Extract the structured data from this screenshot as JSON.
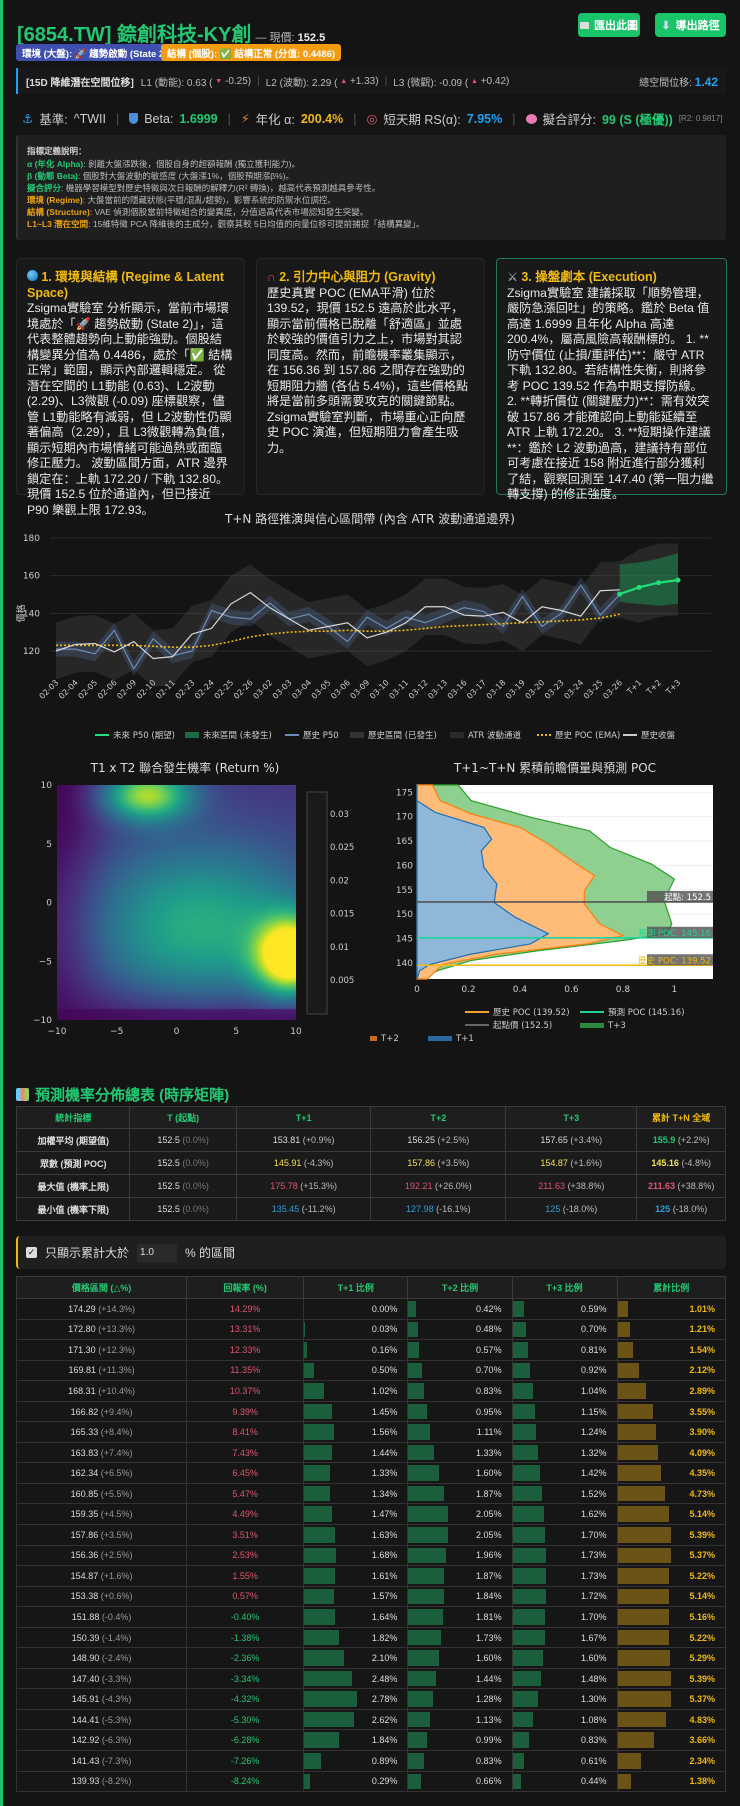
{
  "header": {
    "title": "[6854.TW] 錼創科技-KY創",
    "price_label": "— 現價:",
    "price": "152.5",
    "export_chart": "匯出此圖",
    "export_path": "導出路徑"
  },
  "badges": {
    "regime": "環境 (大盤): 🚀 趨勢啟動 (State 2)",
    "structure": "結構 (個股): ✅ 結構正常 (分值: 0.4486)",
    "regime_color": "#3f4fb0",
    "structure_color": "#f39c12"
  },
  "latent": {
    "label": "[15D 降維潛在空間位移]",
    "l1": "L1 (動能): 0.63 (",
    "l1_arrow": "▼",
    "l1_delta": "-0.25)",
    "l2": "L2 (波動): 2.29 (",
    "l2_arrow": "▲",
    "l2_delta": "+1.33)",
    "l3": "L3 (微觀): -0.09 (",
    "l3_arrow": "▲",
    "l3_delta": "+0.42)",
    "total_label": "總空間位移:",
    "total": "1.42"
  },
  "metrics": {
    "bench_label": "基準:",
    "bench": "^TWII",
    "beta_label": "Beta:",
    "beta": "1.6999",
    "alpha_label": "年化 α:",
    "alpha": "200.4%",
    "rs_label": "短天期 RS(α):",
    "rs": "7.95%",
    "fit_label": "擬合評分:",
    "fit": "99 (S (極優))",
    "r2": "[R2: 0.9817]"
  },
  "defs": {
    "title": "指標定義說明：",
    "items": [
      {
        "k": "α (年化 Alpha)",
        "v": ": 剝離大盤漲跌後，個股自身的超額報酬 (獨立獲利能力)。"
      },
      {
        "k": "β (動態 Beta)",
        "v": ": 個股對大盤波動的敏感度 (大盤漲1%，個股預期漲β%)。"
      },
      {
        "k": "擬合評分",
        "v": ": 機器學習模型對歷史特徵與次日報酬的解釋力(R² 轉換)，越高代表預測越具參考性。"
      },
      {
        "k": "環境 (Regime)",
        "v": ": 大盤當前的隱藏狀態(平穩/混亂/趨勢)，影響系統的防禦水位調控。"
      },
      {
        "k": "結構 (Structure)",
        "v": ": VAE 偵測個股當前特徵組合的變異度，分值過高代表市場認知發生突變。"
      },
      {
        "k": "L1~L3 潛在空間",
        "v": ": 15維特徵 PCA 降維後的主成分，觀察其較 5日均值的向量位移可提前捕捉「結構異變」。"
      }
    ]
  },
  "cards": [
    {
      "title": "1. 環境與結構 (Regime & Latent Space)",
      "body": "Zsigma實驗室 分析顯示，當前市場環境處於「🚀 趨勢啟動 (State 2)」，這代表整體趨勢向上動能強勁。個股結構變異分值為 0.4486，處於「✅ 結構正常」範圍，顯示內部邏輯穩定。 從潛在空間的 L1動能 (0.63)、L2波動 (2.29)、L3微觀 (-0.09) 座標觀察，儘管 L1動能略有減弱，但 L2波動性仍顯著偏高（2.29），且 L3微觀轉為負值，顯示短期內市場情緒可能過熱或面臨修正壓力。 波動區間方面，ATR 邊界鎖定在：上軌 172.20 / 下軌 132.80。現價 152.5 位於通道內，但已接近 P90 樂觀上限 172.93。"
    },
    {
      "title": "2. 引力中心與阻力 (Gravity)",
      "body": "歷史真實 POC (EMA平滑) 位於 139.52，現價 152.5 遠高於此水平，顯示當前價格已脫離「舒適區」並處於較強的價值引力之上，市場對其認同度高。然而，前瞻機率叢集顯示，在 156.36 到 157.86 之間存在強勁的短期阻力牆 (各佔 5.4%)，這些價格點將是當前多頭需要攻克的關鍵節點。Zsigma實驗室判斷，市場重心正向歷史 POC 演進，但短期阻力會產生吸力。"
    },
    {
      "title": "3. 操盤劇本 (Execution)",
      "body": "Zsigma實驗室 建議採取「順勢管理，嚴防急漲回吐」的策略。鑑於 Beta 值高達 1.6999 且年化 Alpha 高達 200.4%，屬高風險高報酬標的。 1. **防守價位 (止損/重評估)**：嚴守 ATR 下軌 132.80。若結構性失衡，則將參考 POC 139.52 作為中期支撐防線。 2. **轉折價位 (關鍵壓力)**：需有效突破 157.86 才能確認向上動能延續至 ATR 上軌 172.20。 3. **短期操作建議**：鑑於 L2 波動過高，建議持有部位可考慮在接近 158 附近進行部分獲利了結，觀察回測至 147.40 (第一阻力繼轉支撐) 的修正強度。"
    }
  ],
  "chart_data": [
    {
      "type": "line",
      "title": "T+N 路徑推演與信心區間帶 (內含 ATR 波動通道邊界)",
      "ylabel": "價格",
      "ylim": [
        98,
        182
      ],
      "yticks": [
        "120",
        "140",
        "160",
        "180"
      ],
      "x": [
        "02-03",
        "02-04",
        "02-05",
        "02-06",
        "02-09",
        "02-10",
        "02-11",
        "02-23",
        "02-24",
        "02-25",
        "02-26",
        "03-02",
        "03-03",
        "03-04",
        "03-05",
        "03-06",
        "03-09",
        "03-10",
        "03-11",
        "03-12",
        "03-13",
        "03-16",
        "03-17",
        "03-18",
        "03-19",
        "03-20",
        "03-23",
        "03-24",
        "03-25",
        "03-26",
        "T+1",
        "T+2",
        "T+3"
      ],
      "hist_close": [
        120,
        123.5,
        124,
        119.5,
        125,
        116,
        117,
        129,
        132,
        145,
        151,
        143,
        137,
        131,
        133,
        135,
        127,
        130,
        135,
        143.5,
        143.5,
        139,
        138.5,
        140.5,
        135,
        143.5,
        141.5,
        138.5,
        152,
        152.5
      ],
      "hist_p50": [
        121,
        121,
        118.5,
        131,
        110.5,
        126.5,
        117.5,
        120,
        141.5,
        138,
        137,
        145.5,
        137,
        139.5,
        133,
        125,
        138,
        132,
        138,
        135,
        139,
        143,
        141,
        133,
        149,
        133,
        140,
        155,
        139,
        150
      ],
      "hist_band_halfwidth": 4,
      "poc_ema": [
        123,
        123,
        123,
        123,
        123,
        122.5,
        122,
        122,
        123,
        125,
        127.5,
        129,
        130,
        130.5,
        130.5,
        131,
        130.5,
        130.5,
        131,
        132,
        133,
        133.5,
        134,
        134.5,
        135,
        135.5,
        136,
        136.5,
        137.5,
        139.5
      ],
      "atr_upper": [
        135,
        138.5,
        139,
        134.5,
        140,
        131,
        132,
        144,
        147,
        160,
        166,
        158,
        152,
        146,
        148,
        150,
        142,
        145,
        150,
        158.5,
        158.5,
        154,
        153.5,
        155.5,
        150,
        158.5,
        156.5,
        153.5,
        167,
        167.5,
        174,
        177,
        177
      ],
      "atr_lower": [
        105,
        108.5,
        109,
        104.5,
        110,
        101,
        102,
        114,
        117,
        130,
        136,
        128,
        122,
        116,
        118,
        120,
        112,
        115,
        120,
        128.5,
        128.5,
        124,
        123.5,
        125.5,
        120,
        128.5,
        126.5,
        123.5,
        137,
        137.5,
        135,
        138,
        139
      ],
      "future_p50": [
        150.2,
        153.81,
        156.25,
        157.65
      ],
      "future_lower": [
        146,
        145,
        144,
        145
      ],
      "future_upper": [
        166,
        167,
        169,
        172
      ],
      "legend": [
        "未來 P50 (期望)",
        "未來區間 (未發生)",
        "歷史 P50",
        "歷史區間 (已發生)",
        "ATR 波動通道",
        "歷史 POC (EMA)",
        "歷史收盤"
      ]
    },
    {
      "type": "heatmap",
      "title": "T1 x T2 聯合發生機率 (Return %)",
      "xlim": [
        -10,
        10
      ],
      "ylim": [
        -10,
        10
      ],
      "xticks": [
        "−10",
        "−5",
        "0",
        "5",
        "10"
      ],
      "yticks": [
        "10",
        "5",
        "0",
        "−5",
        "−10"
      ],
      "colorbar_ticks": [
        "0.03",
        "0.025",
        "0.02",
        "0.015",
        "0.01",
        "0.005"
      ],
      "peaks": [
        {
          "x": 9.5,
          "y": -4.5,
          "value": 0.034,
          "sx": 2.0,
          "sy": 2.2
        },
        {
          "x": -2.5,
          "y": 9.2,
          "value": 0.024,
          "sx": 2.5,
          "sy": 1.5
        },
        {
          "x": 2,
          "y": -2,
          "value": 0.016,
          "sx": 7,
          "sy": 5
        }
      ],
      "base": 0.005
    },
    {
      "type": "area",
      "title": "T+1~T+N 累積前瞻價量與預測 POC",
      "xlim": [
        0,
        1.15
      ],
      "ylim": [
        136.7,
        176.5
      ],
      "xticks": [
        "0",
        "0.2",
        "0.4",
        "0.6",
        "0.8",
        "1"
      ],
      "yticks": [
        "140",
        "145",
        "150",
        "155",
        "160",
        "165",
        "170",
        "175"
      ],
      "t1": [
        [
          176.5,
          0
        ],
        [
          173.3,
          0
        ],
        [
          170.9,
          0.07
        ],
        [
          167.8,
          0.26
        ],
        [
          165.4,
          0.29
        ],
        [
          163,
          0.25
        ],
        [
          159.6,
          0.26
        ],
        [
          156.2,
          0.31
        ],
        [
          152.4,
          0.3
        ],
        [
          149.4,
          0.38
        ],
        [
          146,
          0.51
        ],
        [
          143.9,
          0.44
        ],
        [
          141.8,
          0.21
        ],
        [
          139.7,
          0.05
        ],
        [
          138.4,
          0.01
        ],
        [
          136.7,
          0
        ]
      ],
      "t2": [
        [
          176.5,
          0.06
        ],
        [
          173.3,
          0.09
        ],
        [
          170.6,
          0.21
        ],
        [
          167.8,
          0.4
        ],
        [
          164.4,
          0.51
        ],
        [
          161,
          0.6
        ],
        [
          157.9,
          0.69
        ],
        [
          154.8,
          0.65
        ],
        [
          152.1,
          0.65
        ],
        [
          148,
          0.71
        ],
        [
          145.6,
          0.8
        ],
        [
          143.9,
          0.66
        ],
        [
          141.8,
          0.31
        ],
        [
          139.7,
          0.1
        ],
        [
          136.7,
          0.04
        ]
      ],
      "t3": [
        [
          176.5,
          0.16
        ],
        [
          173.3,
          0.21
        ],
        [
          169.9,
          0.44
        ],
        [
          167.1,
          0.67
        ],
        [
          163.7,
          0.75
        ],
        [
          160.3,
          0.91
        ],
        [
          157.2,
          1.0
        ],
        [
          152.8,
          0.96
        ],
        [
          148,
          0.99
        ],
        [
          146,
          0.97
        ],
        [
          144.6,
          0.8
        ],
        [
          142.5,
          0.47
        ],
        [
          140.5,
          0.21
        ],
        [
          138.4,
          0.08
        ],
        [
          136.7,
          0.01
        ]
      ],
      "hist_poc": 139.52,
      "pred_poc": 145.16,
      "start": 152.5,
      "labels": {
        "start": "起點: 152.5",
        "pred": "預測 POC: 145.16",
        "hist": "歷史 POC: 139.52"
      },
      "legend": [
        "歷史 POC (139.52)",
        "預測 POC (145.16)",
        "起點價 (152.5)",
        "T+3",
        "T+2",
        "T+1"
      ]
    }
  ],
  "summary": {
    "title": "預測機率分佈總表 (時序矩陣)",
    "headers": [
      "統計指標",
      "T (起點)",
      "T+1",
      "T+2",
      "T+3",
      "累計 T+N 全域"
    ],
    "rows": [
      {
        "label": "加權平均 (期望值)",
        "color": "#dddddd",
        "cum_color": "#21c873",
        "cells": [
          [
            "152.5",
            "(0.0%)"
          ],
          [
            "153.81",
            "(+0.9%)"
          ],
          [
            "156.25",
            "(+2.5%)"
          ],
          [
            "157.65",
            "(+3.4%)"
          ],
          [
            "155.9",
            "(+2.2%)"
          ]
        ]
      },
      {
        "label": "眾數 (預測 POC)",
        "color": "#f5e050",
        "cum_color": "#f5e050",
        "cells": [
          [
            "152.5",
            "(0.0%)"
          ],
          [
            "145.91",
            "(-4.3%)"
          ],
          [
            "157.86",
            "(+3.5%)"
          ],
          [
            "154.87",
            "(+1.6%)"
          ],
          [
            "145.16",
            "(-4.8%)"
          ]
        ]
      },
      {
        "label": "最大值 (機率上限)",
        "color": "#e0556f",
        "cum_color": "#e0556f",
        "cells": [
          [
            "152.5",
            "(0.0%)"
          ],
          [
            "175.78",
            "(+15.3%)"
          ],
          [
            "192.21",
            "(+26.0%)"
          ],
          [
            "211.63",
            "(+38.8%)"
          ],
          [
            "211.63",
            "(+38.8%)"
          ]
        ]
      },
      {
        "label": "最小值 (機率下限)",
        "color": "#2a9fd8",
        "cum_color": "#2a9fd8",
        "cells": [
          [
            "152.5",
            "(0.0%)"
          ],
          [
            "135.45",
            "(-11.2%)"
          ],
          [
            "127.98",
            "(-16.1%)"
          ],
          [
            "125",
            "(-18.0%)"
          ],
          [
            "125",
            "(-18.0%)"
          ]
        ]
      }
    ]
  },
  "filter": {
    "label": "只顯示累計大於",
    "value": "1.0",
    "suffix": "% 的區間",
    "checked": true
  },
  "dist": {
    "headers": [
      "價格區間 (△%)",
      "回報率 (%)",
      "T+1 比例",
      "T+2 比例",
      "T+3 比例",
      "累計比例"
    ],
    "rows": [
      [
        "174.29",
        "(+14.3%)",
        "14.29%",
        0.0,
        0.42,
        0.59,
        1.01
      ],
      [
        "172.80",
        "(+13.3%)",
        "13.31%",
        0.03,
        0.48,
        0.7,
        1.21
      ],
      [
        "171.30",
        "(+12.3%)",
        "12.33%",
        0.16,
        0.57,
        0.81,
        1.54
      ],
      [
        "169.81",
        "(+11.3%)",
        "11.35%",
        0.5,
        0.7,
        0.92,
        2.12
      ],
      [
        "168.31",
        "(+10.4%)",
        "10.37%",
        1.02,
        0.83,
        1.04,
        2.89
      ],
      [
        "166.82",
        "(+9.4%)",
        "9.39%",
        1.45,
        0.95,
        1.15,
        3.55
      ],
      [
        "165.33",
        "(+8.4%)",
        "8.41%",
        1.56,
        1.11,
        1.24,
        3.9
      ],
      [
        "163.83",
        "(+7.4%)",
        "7.43%",
        1.44,
        1.33,
        1.32,
        4.09
      ],
      [
        "162.34",
        "(+6.5%)",
        "6.45%",
        1.33,
        1.6,
        1.42,
        4.35
      ],
      [
        "160.85",
        "(+5.5%)",
        "5.47%",
        1.34,
        1.87,
        1.52,
        4.73
      ],
      [
        "159.35",
        "(+4.5%)",
        "4.49%",
        1.47,
        2.05,
        1.62,
        5.14
      ],
      [
        "157.86",
        "(+3.5%)",
        "3.51%",
        1.63,
        2.05,
        1.7,
        5.39
      ],
      [
        "156.36",
        "(+2.5%)",
        "2.53%",
        1.68,
        1.96,
        1.73,
        5.37
      ],
      [
        "154.87",
        "(+1.6%)",
        "1.55%",
        1.61,
        1.87,
        1.73,
        5.22
      ],
      [
        "153.38",
        "(+0.6%)",
        "0.57%",
        1.57,
        1.84,
        1.72,
        5.14
      ],
      [
        "151.88",
        "(-0.4%)",
        "-0.40%",
        1.64,
        1.81,
        1.7,
        5.16
      ],
      [
        "150.39",
        "(-1.4%)",
        "-1.38%",
        1.82,
        1.73,
        1.67,
        5.22
      ],
      [
        "148.90",
        "(-2.4%)",
        "-2.36%",
        2.1,
        1.6,
        1.6,
        5.29
      ],
      [
        "147.40",
        "(-3.3%)",
        "-3.34%",
        2.48,
        1.44,
        1.48,
        5.39
      ],
      [
        "145.91",
        "(-4.3%)",
        "-4.32%",
        2.78,
        1.28,
        1.3,
        5.37
      ],
      [
        "144.41",
        "(-5.3%)",
        "-5.30%",
        2.62,
        1.13,
        1.08,
        4.83
      ],
      [
        "142.92",
        "(-6.3%)",
        "-6.28%",
        1.84,
        0.99,
        0.83,
        3.66
      ],
      [
        "141.43",
        "(-7.3%)",
        "-7.26%",
        0.89,
        0.83,
        0.61,
        2.34
      ],
      [
        "139.93",
        "(-8.2%)",
        "-8.24%",
        0.29,
        0.66,
        0.44,
        1.38
      ]
    ]
  },
  "colors": {
    "accent": "#21c873",
    "gold": "#f0b90b",
    "cyan": "#1da1f2",
    "up": "#e0556f",
    "down": "#21c873"
  }
}
